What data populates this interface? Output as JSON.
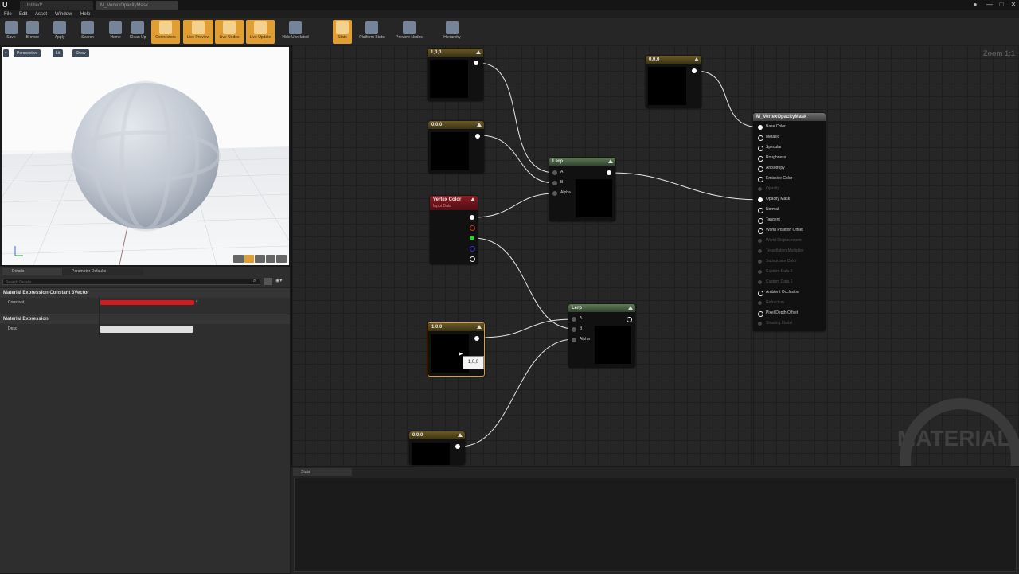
{
  "titlebar": {
    "tabs": [
      "Untitled*",
      "M_VertexOpacityMask"
    ],
    "controls": [
      "●",
      "—",
      "□",
      "✕"
    ]
  },
  "menu": [
    "File",
    "Edit",
    "Asset",
    "Window",
    "Help"
  ],
  "toolbar": [
    {
      "label": "Save",
      "icon": "save-icon",
      "active": false
    },
    {
      "label": "Browse",
      "icon": "browse-icon",
      "active": false
    },
    {
      "label": "Apply",
      "icon": "apply-icon",
      "active": false
    },
    {
      "label": "Search",
      "icon": "search-icon",
      "active": false
    },
    {
      "label": "Home",
      "icon": "home-icon",
      "active": false
    },
    {
      "label": "Clean Up",
      "icon": "clean-up-icon",
      "active": false
    },
    {
      "label": "Connectors",
      "icon": "connectors-icon",
      "active": true
    },
    {
      "label": "Live Preview",
      "icon": "live-preview-icon",
      "active": true
    },
    {
      "label": "Live Nodes",
      "icon": "live-nodes-icon",
      "active": true
    },
    {
      "label": "Live Update",
      "icon": "live-update-icon",
      "active": true
    },
    {
      "label": "Hide Unrelated",
      "icon": "hide-unrelated-icon",
      "active": false
    },
    {
      "label": "Stats",
      "icon": "stats-icon",
      "active": true
    },
    {
      "label": "Platform Stats",
      "icon": "platform-stats-icon",
      "active": false
    },
    {
      "label": "Preview Nodes",
      "icon": "preview-nodes-icon",
      "active": false
    },
    {
      "label": "Hierarchy",
      "icon": "hierarchy-icon",
      "active": false
    }
  ],
  "viewport": {
    "buttons": [
      "Perspective",
      "Lit",
      "Show"
    ]
  },
  "details": {
    "tabs": [
      "Details",
      "Parameter Defaults"
    ],
    "search_placeholder": "Search Details",
    "section1": "Material Expression Constant 3Vector",
    "constant_label": "Constant",
    "section2": "Material Expression",
    "desc_label": "Desc"
  },
  "graph": {
    "zoom": "Zoom 1:1",
    "watermark": "MATERIAL",
    "tooltip": "1,0,0",
    "const_nodes": [
      {
        "id": "c1",
        "title": "1,0,0"
      },
      {
        "id": "c2",
        "title": "0,0,0"
      },
      {
        "id": "c3",
        "title": "0,0,0"
      },
      {
        "id": "c4",
        "title": "1,0,0"
      },
      {
        "id": "c5",
        "title": "0,0,0"
      }
    ],
    "lerp_title": "Lerp",
    "lerp_pins": [
      "A",
      "B",
      "Alpha"
    ],
    "vertex_color": {
      "title": "Vertex Color",
      "subtitle": "Input Data"
    },
    "material": {
      "title": "M_VertexOpacityMask",
      "pins": [
        {
          "label": "Base Color",
          "on": true,
          "connected": true
        },
        {
          "label": "Metallic",
          "on": true,
          "connected": false
        },
        {
          "label": "Specular",
          "on": true,
          "connected": false
        },
        {
          "label": "Roughness",
          "on": true,
          "connected": false
        },
        {
          "label": "Anisotropy",
          "on": true,
          "connected": false
        },
        {
          "label": "Emissive Color",
          "on": true,
          "connected": false
        },
        {
          "label": "Opacity",
          "on": false,
          "connected": false
        },
        {
          "label": "Opacity Mask",
          "on": true,
          "connected": true
        },
        {
          "label": "Normal",
          "on": true,
          "connected": false
        },
        {
          "label": "Tangent",
          "on": true,
          "connected": false
        },
        {
          "label": "World Position Offset",
          "on": true,
          "connected": false
        },
        {
          "label": "World Displacement",
          "on": false,
          "connected": false
        },
        {
          "label": "Tessellation Multiplier",
          "on": false,
          "connected": false
        },
        {
          "label": "Subsurface Color",
          "on": false,
          "connected": false
        },
        {
          "label": "Custom Data 0",
          "on": false,
          "connected": false
        },
        {
          "label": "Custom Data 1",
          "on": false,
          "connected": false
        },
        {
          "label": "Ambient Occlusion",
          "on": true,
          "connected": false
        },
        {
          "label": "Refraction",
          "on": false,
          "connected": false
        },
        {
          "label": "Pixel Depth Offset",
          "on": true,
          "connected": false
        },
        {
          "label": "Shading Model",
          "on": false,
          "connected": false
        }
      ]
    }
  },
  "stats": {
    "tab": "Stats"
  },
  "colors": {
    "accent": "#e19e33",
    "constant_bar": "#d41a1a",
    "wire": "#e6e6e6"
  }
}
